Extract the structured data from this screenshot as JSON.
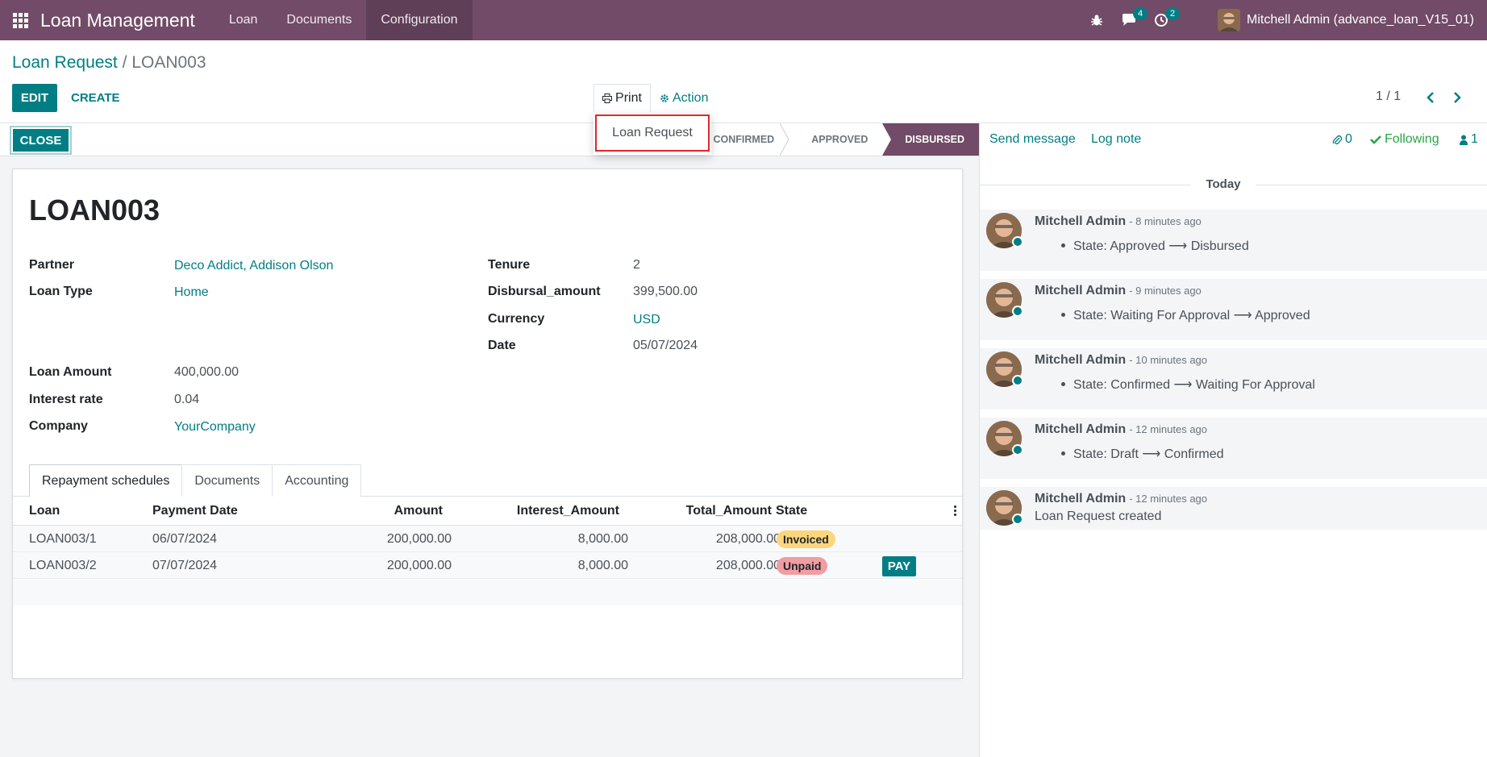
{
  "navbar": {
    "app_title": "Loan Management",
    "menus": [
      "Loan",
      "Documents",
      "Configuration"
    ],
    "chat_badge": "4",
    "activity_badge": "2",
    "user_name": "Mitchell Admin (advance_loan_V15_01)"
  },
  "control": {
    "breadcrumb_parent": "Loan Request",
    "breadcrumb_sep": "/",
    "breadcrumb_current": "LOAN003",
    "edit_label": "EDIT",
    "create_label": "CREATE",
    "print_label": "Print",
    "action_label": "Action",
    "pager": "1 / 1"
  },
  "print_dropdown": {
    "items": [
      "Loan Request"
    ]
  },
  "statusbar": {
    "close_label": "CLOSE",
    "stages": [
      "CONFIRMED",
      "APPROVED",
      "DISBURSED"
    ],
    "active_stage": "DISBURSED"
  },
  "form": {
    "title": "LOAN003",
    "left_fields": [
      {
        "label": "Partner",
        "value": "Deco Addict, Addison Olson"
      },
      {
        "label": "Loan Type",
        "value": "Home"
      },
      {
        "label": "Loan Amount",
        "value": "400,000.00"
      },
      {
        "label": "Interest rate",
        "value": "0.04"
      },
      {
        "label": "Company",
        "value": "YourCompany"
      }
    ],
    "right_fields": [
      {
        "label": "Tenure",
        "value": "2"
      },
      {
        "label": "Disbursal_amount",
        "value": "399,500.00"
      },
      {
        "label": "Currency",
        "value": "USD"
      },
      {
        "label": "Date",
        "value": "05/07/2024"
      }
    ],
    "tabs": [
      "Repayment schedules",
      "Documents",
      "Accounting"
    ]
  },
  "table": {
    "columns": [
      "Loan",
      "Payment Date",
      "Amount",
      "Interest_Amount",
      "Total_Amount",
      "State"
    ],
    "rows": [
      {
        "loan": "LOAN003/1",
        "date": "06/07/2024",
        "amount": "200,000.00",
        "interest": "8,000.00",
        "total": "208,000.00",
        "state": "Invoiced"
      },
      {
        "loan": "LOAN003/2",
        "date": "07/07/2024",
        "amount": "200,000.00",
        "interest": "8,000.00",
        "total": "208,000.00",
        "state": "Unpaid",
        "action": "PAY"
      }
    ]
  },
  "chatter": {
    "send_message": "Send message",
    "log_note": "Log note",
    "attachments": "0",
    "following": "Following",
    "followers": "1",
    "today": "Today",
    "messages": [
      {
        "author": "Mitchell Admin",
        "time": "- 8 minutes ago",
        "body": "State: Approved ⟶ Disbursed"
      },
      {
        "author": "Mitchell Admin",
        "time": "- 9 minutes ago",
        "body": "State: Waiting For Approval ⟶ Approved"
      },
      {
        "author": "Mitchell Admin",
        "time": "- 10 minutes ago",
        "body": "State: Confirmed ⟶ Waiting For Approval"
      },
      {
        "author": "Mitchell Admin",
        "time": "- 12 minutes ago",
        "body": "State: Draft ⟶ Confirmed"
      },
      {
        "author": "Mitchell Admin",
        "time": "- 12 minutes ago",
        "body": "Loan Request created"
      }
    ]
  },
  "colors": {
    "brand": "#714b67",
    "accent": "#017e84"
  }
}
